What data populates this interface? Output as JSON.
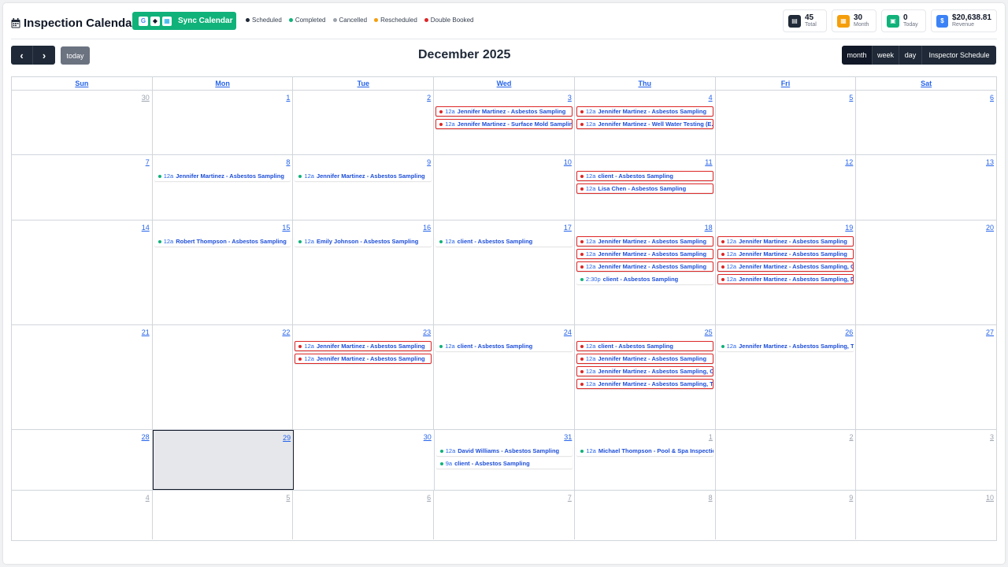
{
  "header": {
    "title": "Inspection Calendar",
    "sync_label": "Sync Calendar",
    "sync_icons": [
      {
        "name": "google-icon",
        "glyph": "G",
        "color": "#4285F4"
      },
      {
        "name": "apple-icon",
        "glyph": "◆",
        "color": "#111827"
      },
      {
        "name": "outlook-icon",
        "glyph": "▦",
        "color": "#0ea5e9"
      }
    ]
  },
  "legend": [
    {
      "label": "Scheduled",
      "color": "#1f2937"
    },
    {
      "label": "Completed",
      "color": "#10b27a"
    },
    {
      "label": "Cancelled",
      "color": "#9ca3af"
    },
    {
      "label": "Rescheduled",
      "color": "#f59e0b"
    },
    {
      "label": "Double Booked",
      "color": "#dc2626"
    }
  ],
  "stats": [
    {
      "value": "45",
      "caption": "Total",
      "icon": "calendar-icon",
      "glyph": "▤",
      "color": "#1f2937"
    },
    {
      "value": "30",
      "caption": "Month",
      "icon": "month-icon",
      "glyph": "▦",
      "color": "#f59e0b"
    },
    {
      "value": "0",
      "caption": "Today",
      "icon": "today-icon",
      "glyph": "▣",
      "color": "#10b27a"
    },
    {
      "value": "$20,638.81",
      "caption": "Revenue",
      "icon": "dollar-icon",
      "glyph": "$",
      "color": "#3b82f6"
    }
  ],
  "toolbar": {
    "prev_glyph": "‹",
    "next_glyph": "›",
    "today_label": "today",
    "month_title": "December 2025",
    "views": [
      {
        "label": "month",
        "active": true
      },
      {
        "label": "week",
        "active": false
      },
      {
        "label": "day",
        "active": false
      },
      {
        "label": "Inspector Schedule",
        "active": false
      }
    ]
  },
  "calendar": {
    "days_of_week": [
      "Sun",
      "Mon",
      "Tue",
      "Wed",
      "Thu",
      "Fri",
      "Sat"
    ],
    "weeks": [
      [
        {
          "num": "30",
          "other": true,
          "events": []
        },
        {
          "num": "1",
          "events": []
        },
        {
          "num": "2",
          "events": []
        },
        {
          "num": "3",
          "events": [
            {
              "time": "12a",
              "title": "Jennifer Martinez - Asbestos Sampling",
              "status": "double"
            },
            {
              "time": "12a",
              "title": "Jennifer Martinez - Surface Mold Sampling",
              "status": "double"
            }
          ]
        },
        {
          "num": "4",
          "events": [
            {
              "time": "12a",
              "title": "Jennifer Martinez - Asbestos Sampling",
              "status": "double"
            },
            {
              "time": "12a",
              "title": "Jennifer Martinez - Well Water Testing (E.coli)",
              "status": "double"
            }
          ]
        },
        {
          "num": "5",
          "events": []
        },
        {
          "num": "6",
          "events": []
        }
      ],
      [
        {
          "num": "7",
          "events": []
        },
        {
          "num": "8",
          "events": [
            {
              "time": "12a",
              "title": "Jennifer Martinez - Asbestos Sampling",
              "status": "completed"
            }
          ]
        },
        {
          "num": "9",
          "events": [
            {
              "time": "12a",
              "title": "Jennifer Martinez - Asbestos Sampling",
              "status": "completed"
            }
          ]
        },
        {
          "num": "10",
          "events": []
        },
        {
          "num": "11",
          "events": [
            {
              "time": "12a",
              "title": "client - Asbestos Sampling",
              "status": "double"
            },
            {
              "time": "12a",
              "title": "Lisa Chen - Asbestos Sampling",
              "status": "double"
            }
          ]
        },
        {
          "num": "12",
          "events": []
        },
        {
          "num": "13",
          "events": []
        }
      ],
      [
        {
          "num": "14",
          "events": []
        },
        {
          "num": "15",
          "events": [
            {
              "time": "12a",
              "title": "Robert Thompson - Asbestos Sampling",
              "status": "completed"
            }
          ]
        },
        {
          "num": "16",
          "events": [
            {
              "time": "12a",
              "title": "Emily Johnson - Asbestos Sampling",
              "status": "completed"
            }
          ]
        },
        {
          "num": "17",
          "events": [
            {
              "time": "12a",
              "title": "client - Asbestos Sampling",
              "status": "completed"
            }
          ]
        },
        {
          "num": "18",
          "events": [
            {
              "time": "12a",
              "title": "Jennifer Martinez - Asbestos Sampling",
              "status": "double"
            },
            {
              "time": "12a",
              "title": "Jennifer Martinez - Asbestos Sampling",
              "status": "double"
            },
            {
              "time": "12a",
              "title": "Jennifer Martinez - Asbestos Sampling",
              "status": "double"
            },
            {
              "time": "2:30p",
              "title": "client - Asbestos Sampling",
              "status": "completed"
            }
          ]
        },
        {
          "num": "19",
          "events": [
            {
              "time": "12a",
              "title": "Jennifer Martinez - Asbestos Sampling",
              "status": "double"
            },
            {
              "time": "12a",
              "title": "Jennifer Martinez - Asbestos Sampling",
              "status": "double"
            },
            {
              "time": "12a",
              "title": "Jennifer Martinez - Asbestos Sampling, C",
              "status": "double"
            },
            {
              "time": "12a",
              "title": "Jennifer Martinez - Asbestos Sampling, D",
              "status": "double"
            }
          ]
        },
        {
          "num": "20",
          "events": []
        }
      ],
      [
        {
          "num": "21",
          "events": []
        },
        {
          "num": "22",
          "events": []
        },
        {
          "num": "23",
          "events": [
            {
              "time": "12a",
              "title": "Jennifer Martinez - Asbestos Sampling",
              "status": "double"
            },
            {
              "time": "12a",
              "title": "Jennifer Martinez - Asbestos Sampling",
              "status": "double"
            }
          ]
        },
        {
          "num": "24",
          "events": [
            {
              "time": "12a",
              "title": "client - Asbestos Sampling",
              "status": "completed"
            }
          ]
        },
        {
          "num": "25",
          "events": [
            {
              "time": "12a",
              "title": "client - Asbestos Sampling",
              "status": "double"
            },
            {
              "time": "12a",
              "title": "Jennifer Martinez - Asbestos Sampling",
              "status": "double"
            },
            {
              "time": "12a",
              "title": "Jennifer Martinez - Asbestos Sampling, C",
              "status": "double"
            },
            {
              "time": "12a",
              "title": "Jennifer Martinez - Asbestos Sampling, T",
              "status": "double"
            }
          ]
        },
        {
          "num": "26",
          "events": [
            {
              "time": "12a",
              "title": "Jennifer Martinez - Asbestos Sampling, Ti",
              "status": "completed"
            }
          ]
        },
        {
          "num": "27",
          "events": []
        }
      ],
      [
        {
          "num": "28",
          "events": []
        },
        {
          "num": "29",
          "today": true,
          "events": []
        },
        {
          "num": "30",
          "events": []
        },
        {
          "num": "31",
          "events": [
            {
              "time": "12a",
              "title": "David Williams - Asbestos Sampling",
              "status": "completed"
            },
            {
              "time": "9a",
              "title": "client - Asbestos Sampling",
              "status": "completed"
            }
          ]
        },
        {
          "num": "1",
          "other": true,
          "events": [
            {
              "time": "12a",
              "title": "Michael Thompson - Pool & Spa Inspection",
              "status": "completed"
            }
          ]
        },
        {
          "num": "2",
          "other": true,
          "events": []
        },
        {
          "num": "3",
          "other": true,
          "events": []
        }
      ],
      [
        {
          "num": "4",
          "other": true,
          "events": []
        },
        {
          "num": "5",
          "other": true,
          "events": []
        },
        {
          "num": "6",
          "other": true,
          "events": []
        },
        {
          "num": "7",
          "other": true,
          "events": []
        },
        {
          "num": "8",
          "other": true,
          "events": []
        },
        {
          "num": "9",
          "other": true,
          "events": []
        },
        {
          "num": "10",
          "other": true,
          "events": []
        }
      ]
    ]
  }
}
